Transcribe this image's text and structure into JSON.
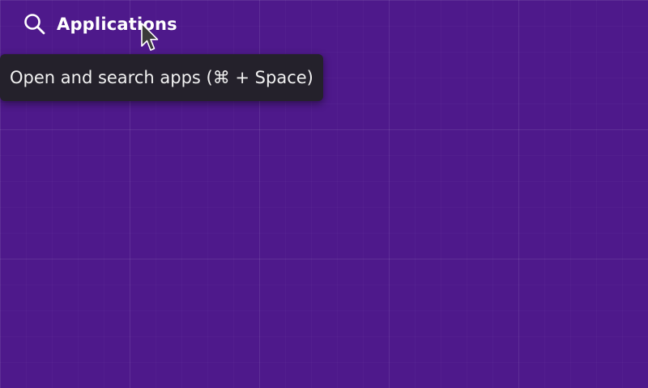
{
  "top_bar": {
    "apps_button": {
      "label": "Applications",
      "icon": "search-icon"
    }
  },
  "tooltip": {
    "text": "Open and search apps (⌘ + Space)"
  },
  "cursor": {
    "icon": "pointer-arrow-icon"
  },
  "colors": {
    "background": "#4e198b",
    "tooltip_bg": "#24212b",
    "text": "#ffffff"
  }
}
